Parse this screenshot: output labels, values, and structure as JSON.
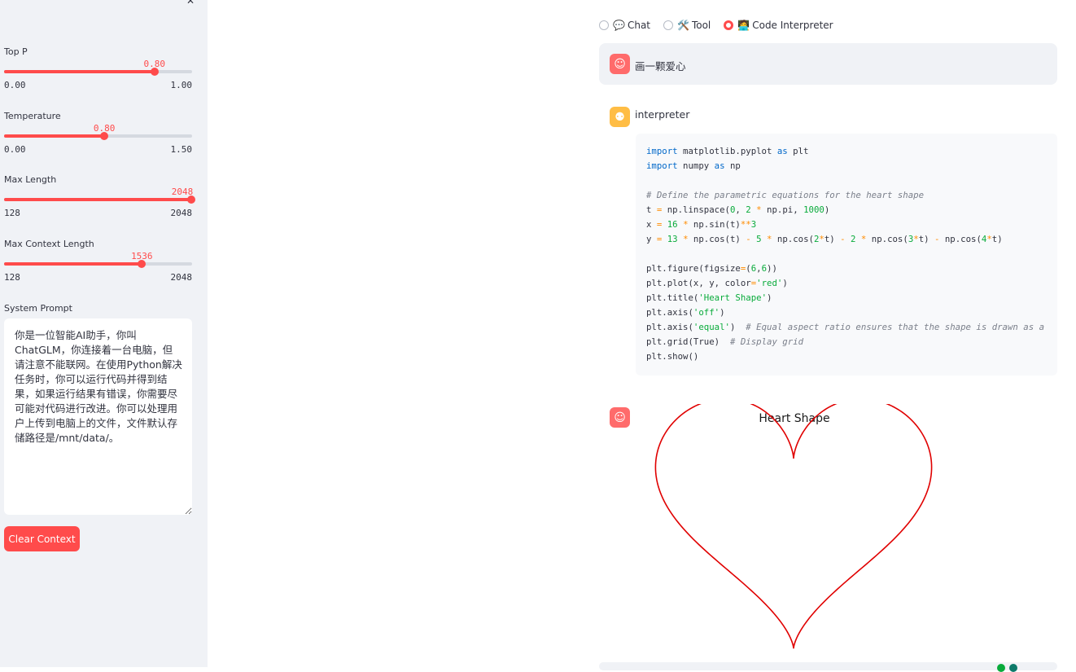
{
  "sidebar": {
    "sliders": [
      {
        "label": "Top P",
        "value": "0.80",
        "min": "0.00",
        "max": "1.00",
        "fraction": 0.8
      },
      {
        "label": "Temperature",
        "value": "0.80",
        "min": "0.00",
        "max": "1.50",
        "fraction": 0.533
      },
      {
        "label": "Max Length",
        "value": "2048",
        "min": "128",
        "max": "2048",
        "fraction": 1.0
      },
      {
        "label": "Max Context Length",
        "value": "1536",
        "min": "128",
        "max": "2048",
        "fraction": 0.733
      }
    ],
    "system_prompt_label": "System Prompt",
    "system_prompt": "你是一位智能AI助手，你叫ChatGLM，你连接着一台电脑，但请注意不能联网。在使用Python解决任务时，你可以运行代码并得到结果，如果运行结果有错误，你需要尽可能对代码进行改进。你可以处理用户上传到电脑上的文件，文件默认存储路径是/mnt/data/。",
    "clear_button": "Clear Context"
  },
  "modes": [
    {
      "label": "Chat",
      "icon": "💬",
      "icon_name": "speech-bubble-icon",
      "selected": false
    },
    {
      "label": "Tool",
      "icon": "🛠️",
      "icon_name": "tools-icon",
      "selected": false
    },
    {
      "label": "Code Interpreter",
      "icon": "🧑‍💻",
      "icon_name": "technologist-icon",
      "selected": true
    }
  ],
  "chat": {
    "user_message": "画一颗爱心",
    "interpreter_name": "interpreter",
    "code_lines": [
      "import matplotlib.pyplot as plt",
      "import numpy as np",
      "",
      "# Define the parametric equations for the heart shape",
      "t = np.linspace(0, 2 * np.pi, 1000)",
      "x = 16 * np.sin(t)**3",
      "y = 13 * np.cos(t) - 5 * np.cos(2*t) - 2 * np.cos(3*t) - np.cos(4*t)",
      "",
      "plt.figure(figsize=(6,6))",
      "plt.plot(x, y, color='red')",
      "plt.title('Heart Shape')",
      "plt.axis('off')",
      "plt.axis('equal')  # Equal aspect ratio ensures that the shape is drawn as a",
      "plt.grid(True)  # Display grid",
      "plt.show()"
    ]
  },
  "chart_data": {
    "type": "line",
    "title": "Heart Shape",
    "xlabel": "",
    "ylabel": "",
    "axis": "off",
    "series": [
      {
        "color": "#e00000",
        "x_expr": "16*sin(t)^3",
        "y_expr": "13*cos(t)-5*cos(2t)-2*cos(3t)-cos(4t)",
        "t_range": [
          0,
          6.2832
        ]
      }
    ]
  },
  "colors": {
    "accent": "#ff4b4b",
    "sidebar_bg": "#f0f2f6",
    "user_avatar": "#ff6b6b",
    "bot_avatar": "#ffbd45"
  }
}
